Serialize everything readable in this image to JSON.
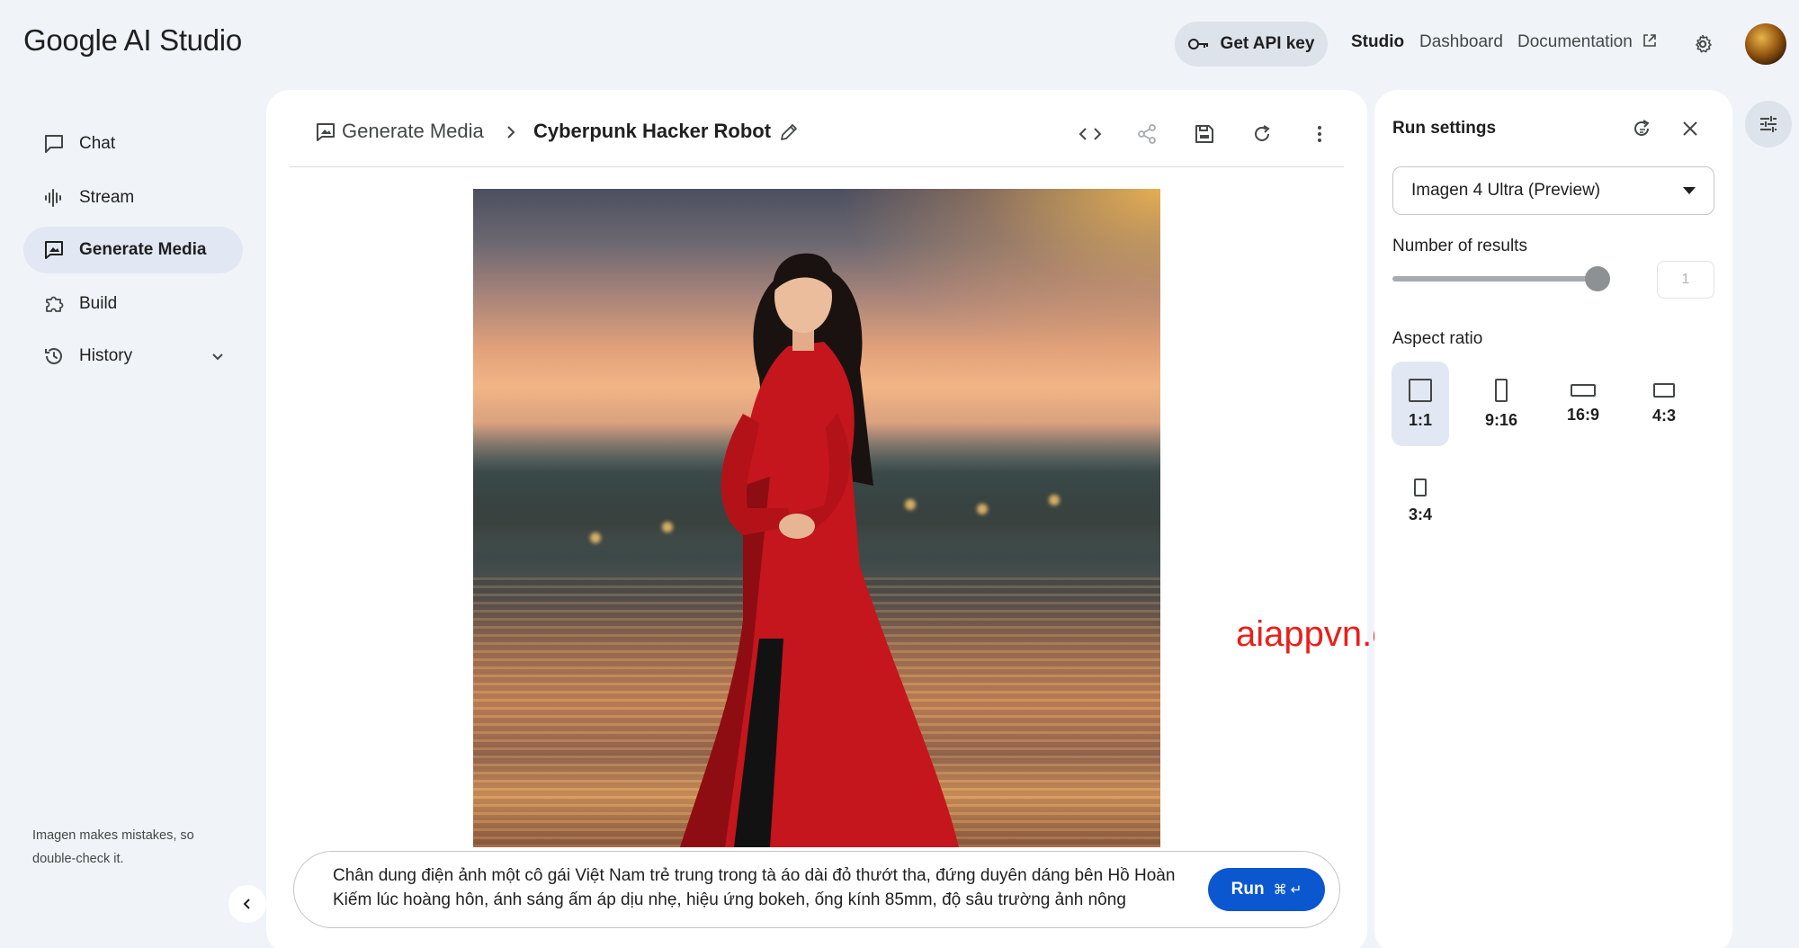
{
  "app": {
    "logo_text": "Google AI Studio",
    "get_api_key_label": "Get API key",
    "top_nav": [
      "Studio",
      "Dashboard",
      "Documentation"
    ],
    "active_top_nav": "Studio"
  },
  "sidebar": {
    "items": [
      {
        "label": "Chat",
        "icon": "chat-icon"
      },
      {
        "label": "Stream",
        "icon": "waveform-icon"
      },
      {
        "label": "Generate Media",
        "icon": "image-icon",
        "active": true
      },
      {
        "label": "Build",
        "icon": "puzzle-icon"
      },
      {
        "label": "History",
        "icon": "history-icon",
        "expandable": true
      }
    ],
    "disclaimer": "Imagen makes mistakes, so double-check it."
  },
  "main": {
    "breadcrumb_parent": "Generate Media",
    "title": "Cyberpunk Hacker Robot",
    "toolbar_icons": [
      "code-icon",
      "share-icon",
      "save-icon",
      "refresh-icon",
      "more-vert-icon"
    ],
    "image_alt": "Portrait of a young Vietnamese woman in red ao dai by a lake at sunset",
    "prompt_text": "Chân dung điện ảnh một cô gái Việt Nam trẻ trung trong tà áo dài đỏ thướt tha, đứng duyên dáng bên Hồ Hoàn Kiếm lúc hoàng hôn, ánh sáng ấm áp dịu nhẹ, hiệu ứng bokeh, ống kính 85mm, độ sâu trường ảnh nông",
    "run_label": "Run",
    "run_shortcut": "⌘ ↵"
  },
  "watermark": "aiappvn.com",
  "run_settings": {
    "title": "Run settings",
    "model": "Imagen 4 Ultra (Preview)",
    "number_of_results_label": "Number of results",
    "number_of_results": "1",
    "slider_fraction": 1.0,
    "aspect_ratio_label": "Aspect ratio",
    "aspect_ratios": [
      "1:1",
      "9:16",
      "16:9",
      "4:3",
      "3:4"
    ],
    "selected_aspect_ratio": "1:1"
  },
  "colors": {
    "accent": "#0b57d0",
    "selected_bg": "#e1e8f4",
    "watermark": "#e8201a",
    "page_bg": "#f0f4f9"
  }
}
